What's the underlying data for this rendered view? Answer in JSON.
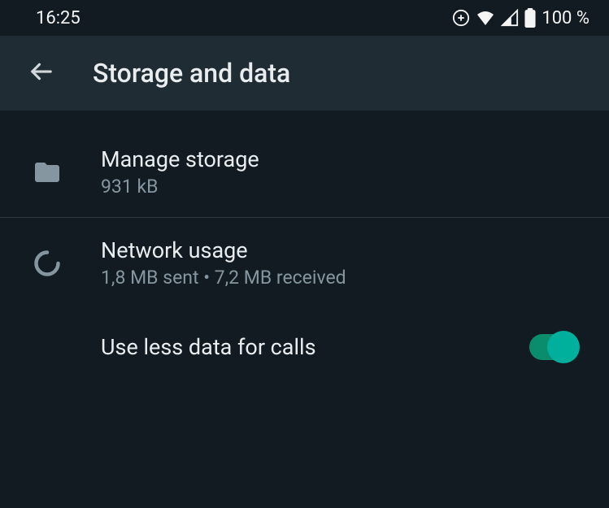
{
  "status": {
    "time": "16:25",
    "battery": "100 %"
  },
  "header": {
    "title": "Storage and data"
  },
  "rows": {
    "manage_storage": {
      "title": "Manage storage",
      "subtitle": "931 kB"
    },
    "network_usage": {
      "title": "Network usage",
      "subtitle": "1,8 MB sent • 7,2 MB received"
    },
    "less_data": {
      "title": "Use less data for calls"
    }
  }
}
